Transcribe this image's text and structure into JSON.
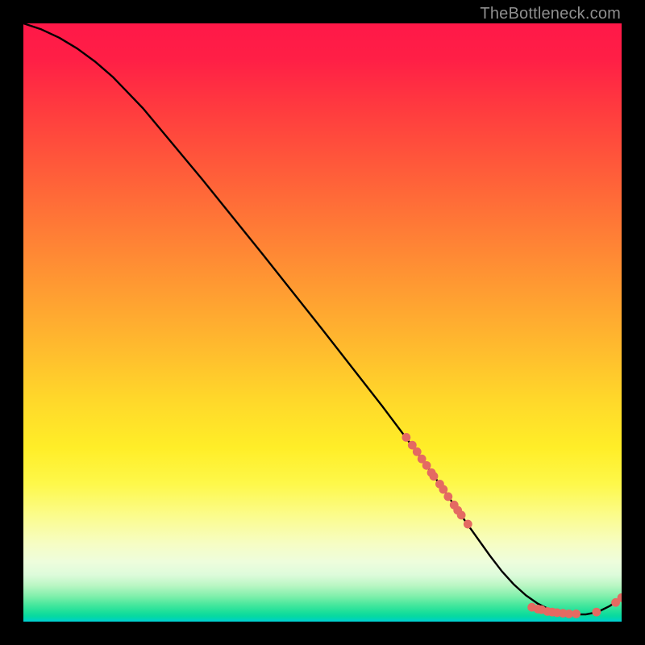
{
  "watermark": "TheBottleneck.com",
  "chart_data": {
    "type": "line",
    "title": "",
    "xlabel": "",
    "ylabel": "",
    "xlim": [
      0,
      100
    ],
    "ylim": [
      0,
      100
    ],
    "grid": false,
    "legend": false,
    "annotations": [],
    "series": [
      {
        "name": "bottleneck-curve",
        "color": "#000000",
        "x": [
          0,
          3,
          6,
          9,
          12,
          15,
          20,
          30,
          40,
          50,
          60,
          66,
          70,
          74,
          78,
          80,
          82,
          84,
          86,
          88,
          90,
          92,
          94,
          96,
          98,
          100
        ],
        "y": [
          100,
          99.0,
          97.6,
          95.8,
          93.6,
          91.0,
          85.8,
          73.8,
          61.4,
          48.8,
          36.0,
          28.0,
          22.4,
          16.6,
          11.0,
          8.4,
          6.2,
          4.4,
          3.0,
          2.0,
          1.4,
          1.2,
          1.2,
          1.6,
          2.6,
          4.0
        ]
      }
    ],
    "marker_clusters": [
      {
        "name": "diagonal-segment-markers",
        "color": "#e46a62",
        "points": [
          {
            "x": 64.0,
            "y": 30.8
          },
          {
            "x": 65.0,
            "y": 29.5
          },
          {
            "x": 65.8,
            "y": 28.4
          },
          {
            "x": 66.6,
            "y": 27.2
          },
          {
            "x": 67.4,
            "y": 26.1
          },
          {
            "x": 68.2,
            "y": 24.9
          },
          {
            "x": 68.6,
            "y": 24.3
          },
          {
            "x": 69.6,
            "y": 23.0
          },
          {
            "x": 70.2,
            "y": 22.1
          },
          {
            "x": 71.0,
            "y": 20.9
          },
          {
            "x": 72.0,
            "y": 19.5
          },
          {
            "x": 72.6,
            "y": 18.6
          },
          {
            "x": 73.2,
            "y": 17.8
          },
          {
            "x": 74.3,
            "y": 16.3
          }
        ]
      },
      {
        "name": "valley-floor-markers",
        "color": "#e46a62",
        "points": [
          {
            "x": 85.0,
            "y": 2.4
          },
          {
            "x": 86.0,
            "y": 2.1
          },
          {
            "x": 86.6,
            "y": 2.0
          },
          {
            "x": 87.6,
            "y": 1.7
          },
          {
            "x": 88.4,
            "y": 1.6
          },
          {
            "x": 89.2,
            "y": 1.5
          },
          {
            "x": 90.2,
            "y": 1.4
          },
          {
            "x": 91.2,
            "y": 1.3
          },
          {
            "x": 92.4,
            "y": 1.3
          },
          {
            "x": 95.8,
            "y": 1.6
          }
        ]
      },
      {
        "name": "tail-uptick-markers",
        "color": "#e46a62",
        "points": [
          {
            "x": 99.0,
            "y": 3.2
          },
          {
            "x": 100.0,
            "y": 4.0
          }
        ]
      }
    ]
  }
}
